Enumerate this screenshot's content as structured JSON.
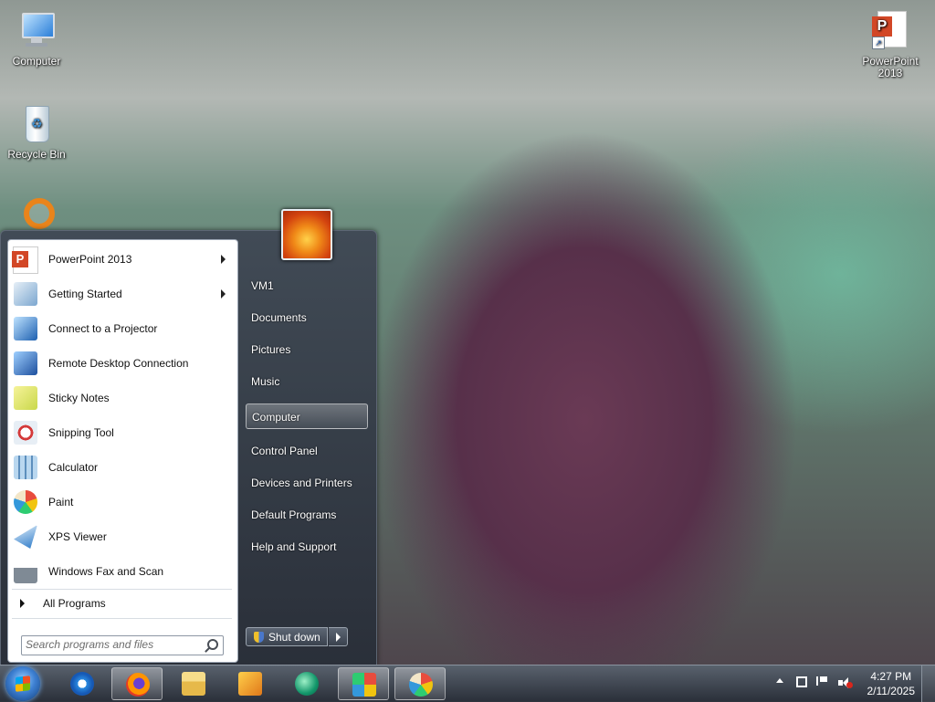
{
  "desktop": {
    "icons": [
      {
        "label": "Computer"
      },
      {
        "label": "Recycle Bin"
      },
      {
        "label": "PowerPoint 2013"
      }
    ]
  },
  "start_menu": {
    "programs": [
      {
        "label": "PowerPoint 2013",
        "icon": "powerpoint-icon",
        "has_submenu": true
      },
      {
        "label": "Getting Started",
        "icon": "getting-started-icon",
        "has_submenu": true
      },
      {
        "label": "Connect to a Projector",
        "icon": "projector-icon",
        "has_submenu": false
      },
      {
        "label": "Remote Desktop Connection",
        "icon": "remote-desktop-icon",
        "has_submenu": false
      },
      {
        "label": "Sticky Notes",
        "icon": "sticky-notes-icon",
        "has_submenu": false
      },
      {
        "label": "Snipping Tool",
        "icon": "snipping-tool-icon",
        "has_submenu": false
      },
      {
        "label": "Calculator",
        "icon": "calculator-icon",
        "has_submenu": false
      },
      {
        "label": "Paint",
        "icon": "paint-icon",
        "has_submenu": false
      },
      {
        "label": "XPS Viewer",
        "icon": "xps-viewer-icon",
        "has_submenu": false
      },
      {
        "label": "Windows Fax and Scan",
        "icon": "fax-scan-icon",
        "has_submenu": false
      }
    ],
    "all_programs": "All Programs",
    "search_placeholder": "Search programs and files",
    "right_items": [
      {
        "label": "VM1",
        "selected": false
      },
      {
        "label": "Documents",
        "selected": false
      },
      {
        "label": "Pictures",
        "selected": false
      },
      {
        "label": "Music",
        "selected": false
      },
      {
        "label": "Computer",
        "selected": true
      },
      {
        "label": "Control Panel",
        "selected": false
      },
      {
        "label": "Devices and Printers",
        "selected": false
      },
      {
        "label": "Default Programs",
        "selected": false
      },
      {
        "label": "Help and Support",
        "selected": false
      }
    ],
    "shutdown_label": "Shut down"
  },
  "taskbar": {
    "buttons": [
      {
        "icon": "internet-explorer-icon",
        "active": false
      },
      {
        "icon": "firefox-icon",
        "active": true
      },
      {
        "icon": "file-explorer-icon",
        "active": false
      },
      {
        "icon": "media-player-icon",
        "active": false
      },
      {
        "icon": "green-app-icon",
        "active": false
      },
      {
        "icon": "control-panel-icon",
        "active": true
      },
      {
        "icon": "paint-icon",
        "active": true
      }
    ],
    "clock": {
      "time": "4:27 PM",
      "date": "2/11/2025"
    }
  }
}
